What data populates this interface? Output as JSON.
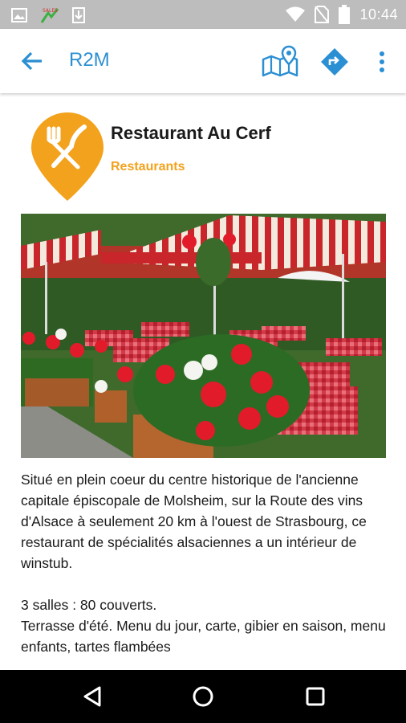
{
  "status_bar": {
    "time": "10:44",
    "icons": [
      "image-icon",
      "sales-app-icon",
      "download-icon",
      "wifi-icon",
      "no-sim-icon",
      "battery-icon"
    ]
  },
  "app_bar": {
    "title": "R2M",
    "accent_color": "#2b8fd3",
    "actions": [
      "back-arrow-icon",
      "map-pin-icon",
      "directions-icon",
      "overflow-menu-icon"
    ]
  },
  "place": {
    "name": "Restaurant Au Cerf",
    "category": "Restaurants",
    "category_color": "#f2a21c",
    "pin_icon": "restaurant-pin-icon"
  },
  "description": "Situé en plein coeur du centre historique de l'ancienne capitale épiscopale de Molsheim, sur la Route des vins d'Alsace à seulement 20 km à l'ouest de Strasbourg, ce restaurant de spécialités alsaciennes a un intérieur de winstub.\n\n3 salles : 80 couverts.\nTerrasse d'été. Menu du jour, carte, gibier en saison, menu enfants, tartes flambées",
  "nav_bar": [
    "nav-back-icon",
    "nav-home-icon",
    "nav-recent-icon"
  ]
}
